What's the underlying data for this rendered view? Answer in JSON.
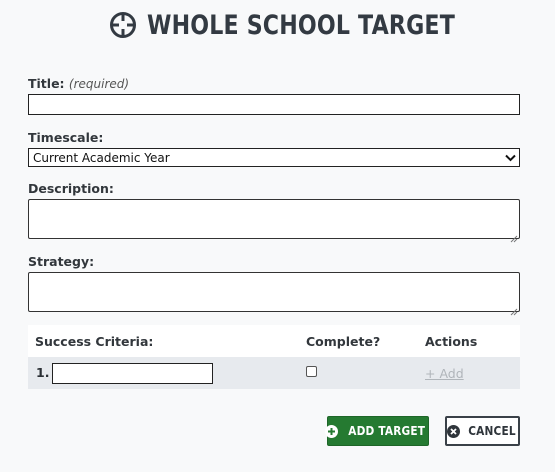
{
  "header": {
    "icon": "crosshair-icon",
    "title": "WHOLE SCHOOL TARGET"
  },
  "form": {
    "title_label": "Title:",
    "title_hint": "(required)",
    "title_value": "",
    "timescale_label": "Timescale:",
    "timescale_selected": "Current Academic Year",
    "description_label": "Description:",
    "description_value": "",
    "strategy_label": "Strategy:",
    "strategy_value": ""
  },
  "criteria": {
    "headers": [
      "Success Criteria:",
      "Complete?",
      "Actions"
    ],
    "rows": [
      {
        "number": "1.",
        "value": "",
        "complete": false,
        "action": "+ Add"
      }
    ]
  },
  "buttons": {
    "add_label": "ADD TARGET",
    "add_icon": "plus-circle-icon",
    "add_color": "#257a31",
    "cancel_label": "CANCEL",
    "cancel_icon": "x-circle-icon"
  }
}
